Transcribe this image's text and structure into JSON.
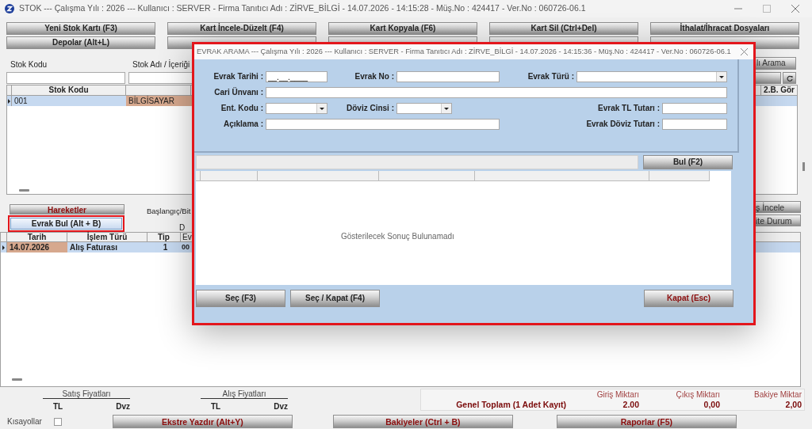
{
  "window": {
    "title": "STOK  ---  Çalışma Yılı : 2026  ---  Kullanıcı : SERVER - Firma Tanıtıcı Adı : ZİRVE_BİLGİ - 14.07.2026 - 14:15:28 - Müş.No : 424417 - Ver.No : 060726-06.1"
  },
  "toolbar": {
    "rows": [
      [
        "Yeni Stok Kartı (F3)",
        "Kart İncele-Düzelt (F4)",
        "Kart Kopyala (F6)",
        "Kart Sil (Ctrl+Del)",
        "İthalat/İhracat Dosyaları"
      ],
      [
        "Depolar (Alt+L)"
      ]
    ]
  },
  "search": {
    "fields": [
      {
        "label": "Stok Kodu"
      },
      {
        "label": "Stok Adı / İçeriği"
      }
    ],
    "button": "lı Arama"
  },
  "stock_grid": {
    "columns": [
      "Stok Kodu",
      "2.B. Gör"
    ],
    "rows": [
      {
        "selected": true,
        "cells": [
          {
            "text": "001",
            "selected": false
          },
          {
            "text": "BİLGİSAYAR",
            "selected": true
          }
        ]
      }
    ]
  },
  "movements": {
    "tab_button": "Hareketler",
    "find_button": "Evrak Bul (Alt + B)",
    "find_highlighted": true,
    "date_label": "Başlangıç/Bit",
    "label_2": "D",
    "right_buttons": [
      "ş İncele",
      "ite Durum"
    ],
    "columns": [
      "Tarih",
      "İşlem Türü",
      "Tip",
      "Ev"
    ],
    "rows": [
      {
        "selected": true,
        "cells": [
          {
            "text": "14.07.2026",
            "selected": true
          },
          {
            "text": "Alış Faturası",
            "selected": false
          },
          {
            "text": "1",
            "selected": false
          },
          {
            "text": "00",
            "selected": false
          }
        ]
      }
    ]
  },
  "prices": [
    {
      "title": "Satış Fiyatları",
      "columns": [
        "TL",
        "Dvz"
      ]
    },
    {
      "title": "Alış Fiyatları",
      "columns": [
        "TL",
        "Dvz"
      ]
    }
  ],
  "totals": {
    "label": "Genel Toplam (1 Adet Kayıt)",
    "columns": [
      {
        "label": "Giriş Miktarı",
        "value": "2.00"
      },
      {
        "label": "Çıkış Miktarı",
        "value": "0,00"
      },
      {
        "label": "Bakiye Miktar",
        "value": "2,00"
      }
    ]
  },
  "shortcuts": {
    "label": "Kısayollar",
    "checked": false
  },
  "bottom_buttons": [
    "Ekstre Yazdır (Alt+Y)",
    "Bakiyeler (Ctrl + B)",
    "Raporlar (F5)"
  ],
  "dialog": {
    "title": "EVRAK ARAMA  ---  Çalışma Yılı : 2026  ---  Kullanıcı : SERVER - Firma Tanıtıcı Adı : ZİRVE_BİLGİ - 14.07.2026 - 14:15:36 - Müş.No : 424417 - Ver.No : 060726-06.1",
    "highlighted": true,
    "form_rows": [
      [
        {
          "label": "Evrak Tarihi :",
          "kind": "date",
          "value": "__.__.____"
        },
        {
          "label": "Evrak No :",
          "kind": "text"
        },
        {
          "label": "Evrak Türü :",
          "kind": "combo"
        }
      ],
      [
        {
          "label": "Cari Ünvanı :",
          "kind": "text"
        }
      ],
      [
        {
          "label": "Ent. Kodu :",
          "kind": "combo"
        },
        {
          "label": "Döviz Cinsi :",
          "kind": "combo"
        },
        {
          "label": "Evrak TL Tutarı :",
          "kind": "text"
        }
      ],
      [
        {
          "label": "Açıklama :",
          "kind": "text"
        },
        {
          "label": "Evrak Döviz Tutarı :",
          "kind": "text"
        }
      ]
    ],
    "find_button": "Bul (F2)",
    "empty_message": "Gösterilecek Sonuç Bulunamadı",
    "buttons": [
      {
        "label": "Seç (F3)",
        "kind": "action"
      },
      {
        "label": "Seç / Kapat (F4)",
        "kind": "action"
      },
      {
        "label": "Kapat (Esc)",
        "kind": "close"
      }
    ]
  }
}
